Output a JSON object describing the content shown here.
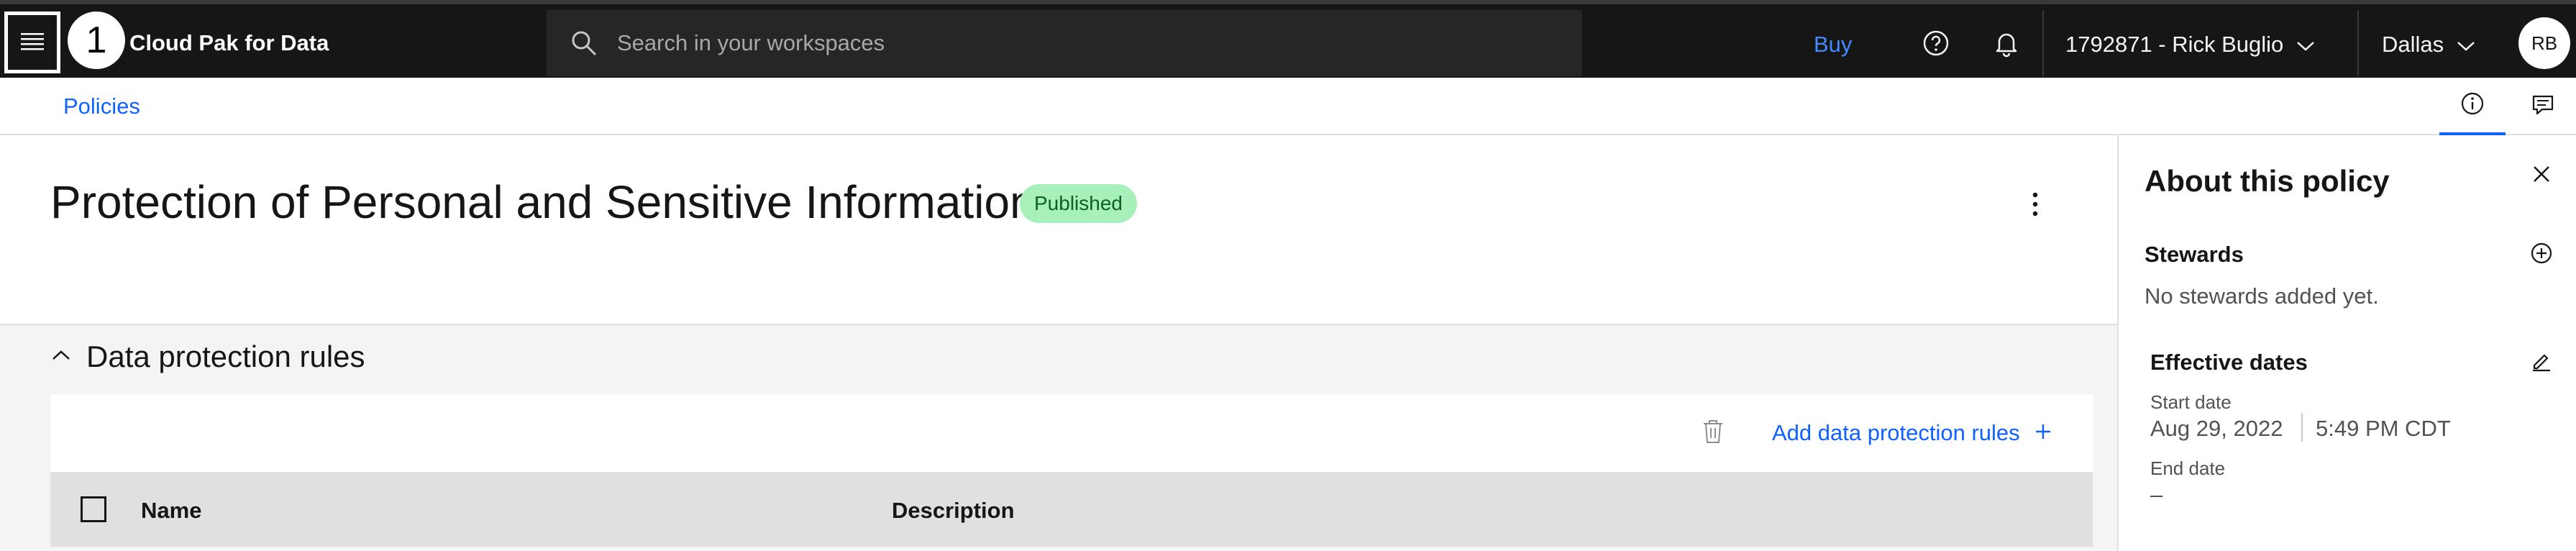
{
  "header": {
    "step_number": "1",
    "brand": "Cloud Pak for Data",
    "search_placeholder": "Search in your workspaces",
    "buy_label": "Buy",
    "account_label": "1792871 - Rick Buglio",
    "region_label": "Dallas",
    "avatar_initials": "RB",
    "icons": [
      "menu-icon",
      "search-icon",
      "help-icon",
      "notification-icon",
      "chevron-down-icon",
      "chevron-down-icon"
    ]
  },
  "breadcrumb": {
    "items": [
      {
        "label": "Policies"
      }
    ],
    "tab_icons": [
      "information-icon",
      "comment-icon"
    ]
  },
  "policy": {
    "title": "Protection of Personal and Sensitive Information",
    "status_badge": "Published",
    "overflow_icon": "overflow-menu-icon"
  },
  "rules_section": {
    "title": "Data protection rules",
    "expanded": true,
    "add_button_label": "Add data protection rules",
    "columns": [
      "Name",
      "Description"
    ],
    "rows": []
  },
  "about_panel": {
    "title": "About this policy",
    "stewards_label": "Stewards",
    "stewards_empty": "No stewards added yet.",
    "effective_dates_label": "Effective dates",
    "start_date_label": "Start date",
    "start_date": "Aug 29, 2022",
    "start_time": "5:49 PM CDT",
    "end_date_label": "End date",
    "end_date": "–"
  },
  "colors": {
    "header_bg": "#161616",
    "link_blue": "#0f62fe",
    "badge_bg": "#a7f0ba",
    "badge_text": "#0e6027"
  }
}
